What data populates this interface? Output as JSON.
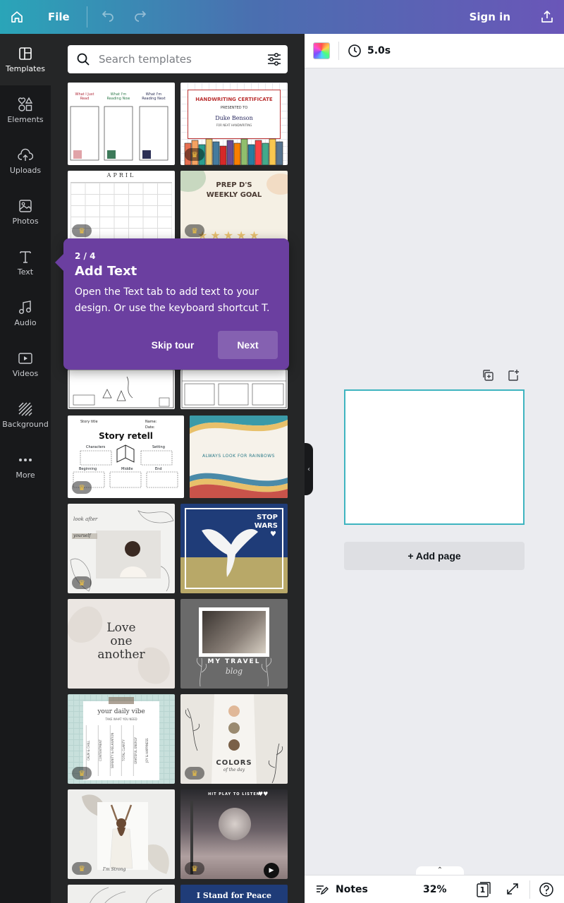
{
  "topbar": {
    "file_label": "File",
    "signin_label": "Sign in"
  },
  "leftnav": {
    "items": [
      {
        "label": "Templates",
        "icon": "templates-icon"
      },
      {
        "label": "Elements",
        "icon": "elements-icon"
      },
      {
        "label": "Uploads",
        "icon": "uploads-icon"
      },
      {
        "label": "Photos",
        "icon": "photos-icon"
      },
      {
        "label": "Text",
        "icon": "text-icon"
      },
      {
        "label": "Audio",
        "icon": "audio-icon"
      },
      {
        "label": "Videos",
        "icon": "videos-icon"
      },
      {
        "label": "Background",
        "icon": "background-icon"
      },
      {
        "label": "More",
        "icon": "more-icon"
      }
    ]
  },
  "search": {
    "placeholder": "Search templates"
  },
  "templates": {
    "t1": {
      "h1": "What I Just Read",
      "h2": "What I'm Reading Now",
      "h3": "What I'm Reading Next"
    },
    "t2": {
      "title": "HANDWRITING CERTIFICATE",
      "sub": "PRESENTED TO",
      "name": "Duke Benson",
      "line": "FOR NEAT HANDWRITING"
    },
    "t3": {
      "month": "APRIL"
    },
    "t4": {
      "title": "PREP D'S WEEKLY GOAL"
    },
    "t6": {
      "title": "Story title",
      "heading": "Story retell",
      "name": "Name:",
      "date": "Date:",
      "c1": "Characters",
      "c2": "Setting",
      "c3": "Beginning",
      "c4": "Middle",
      "c5": "End"
    },
    "t7": {
      "text": "ALWAYS LOOK FOR RAINBOWS"
    },
    "t8": {
      "script1": "look after",
      "script2": "yourself"
    },
    "t9": {
      "text1": "STOP",
      "text2": "WARS"
    },
    "t10": {
      "line1": "Love",
      "line2": "one",
      "line3": "another"
    },
    "t11": {
      "title": "MY TRAVEL",
      "script": "blog"
    },
    "t12": {
      "title": "your daily vibe",
      "sub": "TAKE WHAT YOU NEED",
      "tabs": [
        "CALM & CHILL",
        "CONTENTMENT",
        "SERENITY & RELAXATION",
        "TOTAL CLARITY",
        "GRATEFUL ENERGY",
        "JOY & HAPPINESS"
      ]
    },
    "t13": {
      "title": "COLORS",
      "script": "of the day"
    },
    "t14": {
      "script": "I'm Strong"
    },
    "t15": {
      "header": "HIT PLAY TO LISTEN"
    },
    "t17": {
      "text": "I Stand for Peace"
    }
  },
  "tour": {
    "step": "2 / 4",
    "title": "Add Text",
    "description": "Open the Text tab to add text to your design. Or use the keyboard shortcut T.",
    "skip_label": "Skip tour",
    "next_label": "Next"
  },
  "editor": {
    "duration": "5.0s",
    "add_page_label": "+ Add page"
  },
  "bottombar": {
    "notes_label": "Notes",
    "zoom": "32%",
    "page_count": "1"
  },
  "colors": {
    "accent_purple": "#6b3fa0",
    "page_border": "#3fb4c0",
    "panel_bg": "#252627",
    "nav_bg": "#18191b"
  }
}
